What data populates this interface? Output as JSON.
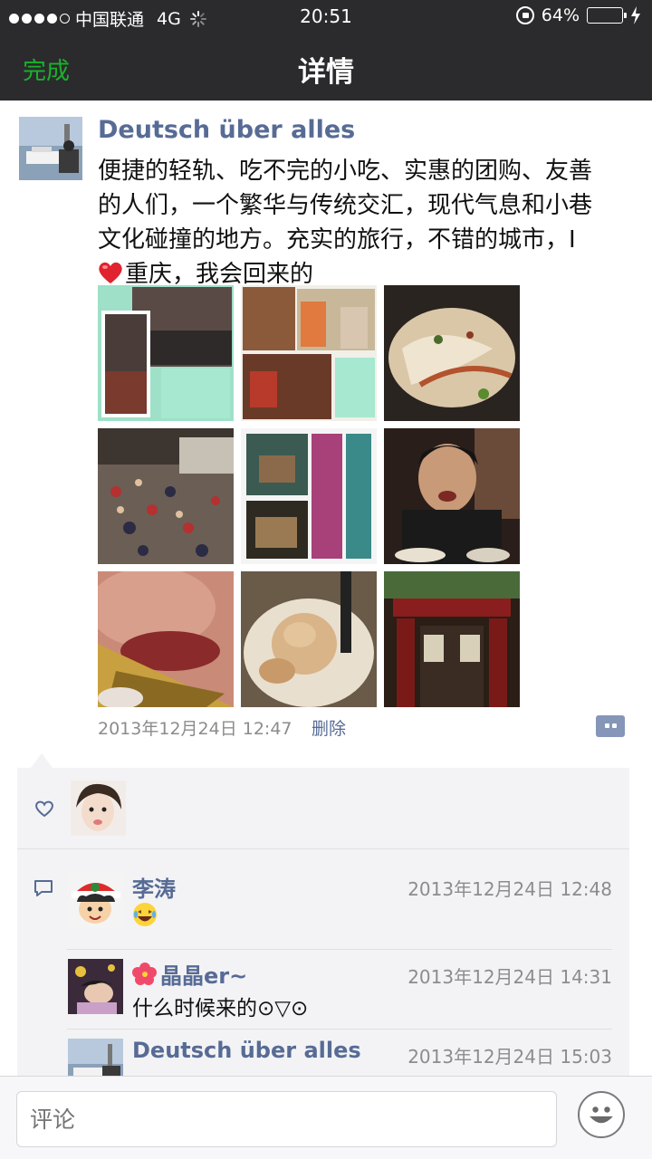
{
  "status_bar": {
    "carrier": "中国联通",
    "network": "4G",
    "time": "20:51",
    "battery_percent": "64%",
    "battery_level": 0.64,
    "battery_color": "#f5c400"
  },
  "nav": {
    "done_label": "完成",
    "title": "详情"
  },
  "post": {
    "author": "Deutsch über alles",
    "text_line1": "便捷的轻轨、吃不完的小吃、实惠的团购、友善",
    "text_line2": "的人们，一个繁华与传统交汇，现代气息和小巷",
    "text_line3": "文化碰撞的地方。充实的旅行，不错的城市，I",
    "text_line4": "重庆，我会回来的",
    "heart_icon": "red-heart-emoji",
    "timestamp": "2013年12月24日 12:47",
    "delete_label": "删除",
    "photo_count": 9
  },
  "comments": [
    {
      "name": "李涛",
      "time": "2013年12月24日 12:48",
      "text": ""
    },
    {
      "name": "晶晶er~",
      "time": "2013年12月24日 14:31",
      "text": "什么时候来的⊙▽⊙"
    },
    {
      "name": "Deutsch über alles",
      "time": "2013年12月24日 15:03",
      "text": ""
    }
  ],
  "comment_bar": {
    "placeholder": "评论"
  },
  "colors": {
    "bar_bg": "#2b2b2d",
    "accent_green": "#1ab22c",
    "name_blue": "#576b95"
  }
}
